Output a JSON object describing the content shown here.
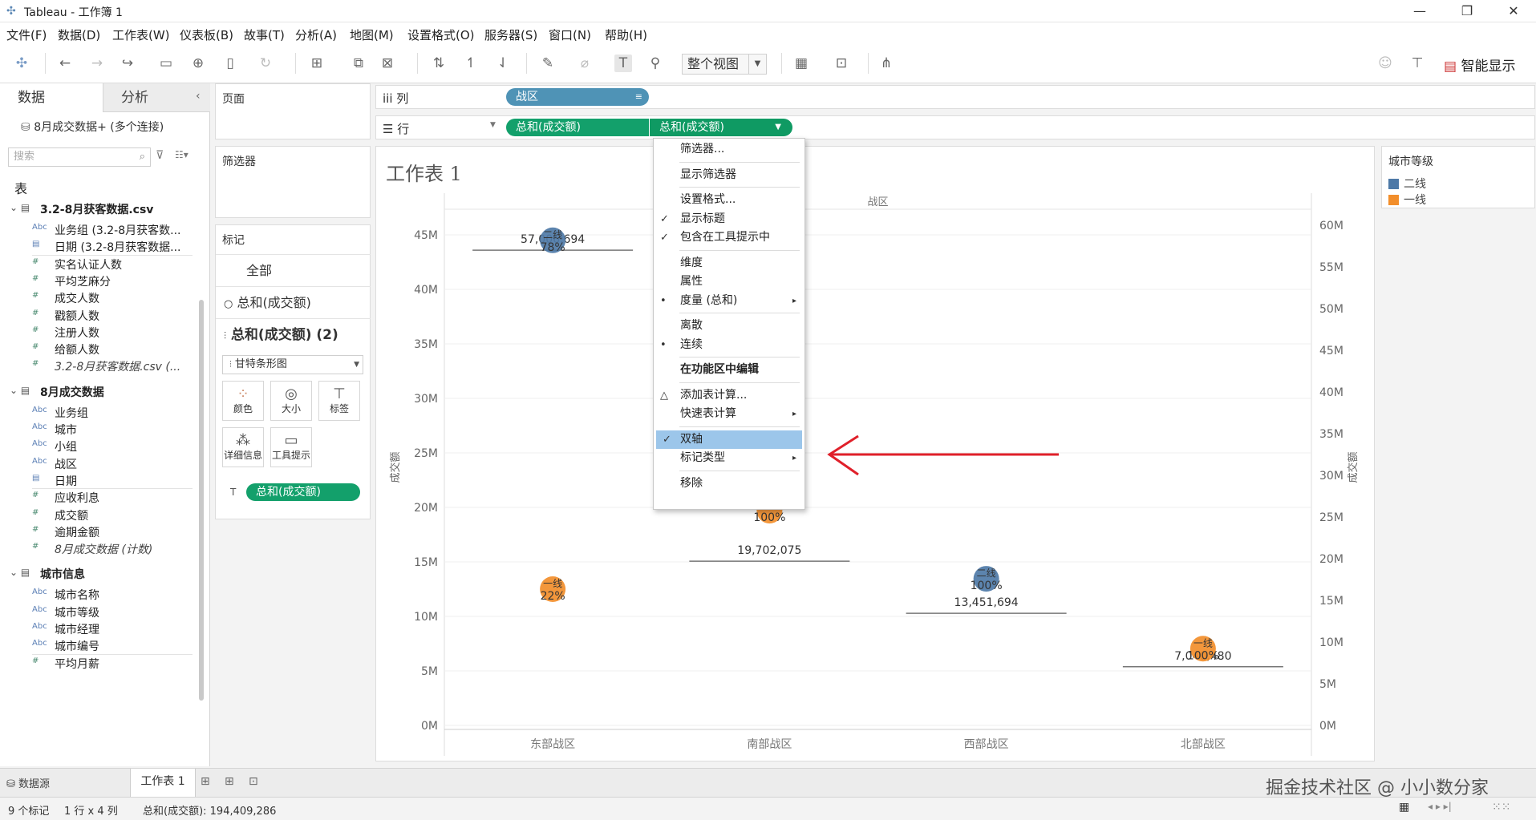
{
  "window": {
    "title": "Tableau - 工作簿 1",
    "minimize": "—",
    "maximize": "❐",
    "close": "✕"
  },
  "menu": [
    "文件(F)",
    "数据(D)",
    "工作表(W)",
    "仪表板(B)",
    "故事(T)",
    "分析(A)",
    "地图(M)",
    "设置格式(O)",
    "服务器(S)",
    "窗口(N)",
    "帮助(H)"
  ],
  "toolbar": {
    "fit_label": "整个视图",
    "show_me_label": "智能显示"
  },
  "left_pane": {
    "tab_data": "数据",
    "tab_analysis": "分析",
    "datasource": "8月成交数据+ (多个连接)",
    "search_placeholder": "搜索",
    "tables_heading": "表",
    "groups": [
      {
        "name": "3.2-8月获客数据.csv",
        "fields": [
          {
            "type": "Abc",
            "name": "业务组 (3.2-8月获客数..."
          },
          {
            "type": "date",
            "name": "日期 (3.2-8月获客数据..."
          },
          {
            "type": "#",
            "name": "实名认证人数"
          },
          {
            "type": "#",
            "name": "平均芝麻分"
          },
          {
            "type": "#",
            "name": "成交人数"
          },
          {
            "type": "#",
            "name": "戳额人数"
          },
          {
            "type": "#",
            "name": "注册人数"
          },
          {
            "type": "#",
            "name": "给额人数"
          },
          {
            "type": "#",
            "name": "3.2-8月获客数据.csv (..."
          }
        ]
      },
      {
        "name": "8月成交数据",
        "fields": [
          {
            "type": "Abc",
            "name": "业务组"
          },
          {
            "type": "Abc",
            "name": "城市"
          },
          {
            "type": "Abc",
            "name": "小组"
          },
          {
            "type": "Abc",
            "name": "战区"
          },
          {
            "type": "date",
            "name": "日期"
          },
          {
            "type": "#",
            "name": "应收利息"
          },
          {
            "type": "#",
            "name": "成交额"
          },
          {
            "type": "#",
            "name": "逾期金额"
          },
          {
            "type": "#",
            "name": "8月成交数据 (计数)"
          }
        ]
      },
      {
        "name": "城市信息",
        "fields": [
          {
            "type": "Abc",
            "name": "城市名称"
          },
          {
            "type": "Abc",
            "name": "城市等级"
          },
          {
            "type": "Abc",
            "name": "城市经理"
          },
          {
            "type": "Abc",
            "name": "城市编号"
          },
          {
            "type": "#",
            "name": "平均月薪"
          }
        ]
      }
    ]
  },
  "cards": {
    "pages": "页面",
    "filters": "筛选器",
    "marks": "标记",
    "marks_all": "全部",
    "marks_m1": "总和(成交额)",
    "marks_m2": "总和(成交额) (2)",
    "mark_type": "甘特条形图",
    "btn_color": "颜色",
    "btn_size": "大小",
    "btn_label": "标签",
    "btn_detail": "详细信息",
    "btn_tooltip": "工具提示",
    "label_pill": "总和(成交额)"
  },
  "shelves": {
    "columns_label": "iii 列",
    "rows_label": "☰ 行",
    "column_pill": "战区",
    "row_pill_1": "总和(成交额)",
    "row_pill_2": "总和(成交额)"
  },
  "view": {
    "sheet_title": "工作表 1"
  },
  "legend": {
    "title": "城市等级",
    "items": [
      {
        "label": "二线",
        "color": "#4e79a7"
      },
      {
        "label": "一线",
        "color": "#f28e2b"
      }
    ]
  },
  "chart_data": {
    "type": "gantt",
    "header": "战区",
    "categories": [
      "东部战区",
      "南部战区",
      "西部战区",
      "北部战区"
    ],
    "ylabel": "成交额",
    "y_left_ticks": [
      "0M",
      "5M",
      "10M",
      "15M",
      "20M",
      "25M",
      "30M",
      "35M",
      "40M",
      "45M"
    ],
    "y_right_ticks": [
      "0M",
      "5M",
      "10M",
      "15M",
      "20M",
      "25M",
      "30M",
      "35M",
      "40M",
      "45M",
      "50M",
      "55M",
      "60M"
    ],
    "ylim_left": [
      0,
      45000000
    ],
    "ylim_right": [
      0,
      60000000
    ],
    "gantt_values": [
      57006694,
      19702075,
      13451694,
      7040480
    ],
    "gantt_labels": [
      "57,006,694",
      "19,702,075",
      "13,451,694",
      "7,040,480"
    ],
    "points": [
      {
        "category": "东部战区",
        "tier": "二线",
        "value": 44500000,
        "label": "78%",
        "tier_label": "二线"
      },
      {
        "category": "东部战区",
        "tier": "一线",
        "value": 12500000,
        "label": "22%",
        "tier_label": "一线"
      },
      {
        "category": "南部战区",
        "tier": "一线",
        "value": 19700000,
        "label": "100%",
        "tier_label": "一线"
      },
      {
        "category": "西部战区",
        "tier": "二线",
        "value": 13450000,
        "label": "100%",
        "tier_label": "二线"
      },
      {
        "category": "北部战区",
        "tier": "一线",
        "value": 7040000,
        "label": "100%",
        "tier_label": "一线"
      }
    ]
  },
  "context_menu": {
    "items": [
      {
        "label": "筛选器...",
        "check": "",
        "sub": false
      },
      {
        "sep": true
      },
      {
        "label": "显示筛选器",
        "check": "",
        "sub": false
      },
      {
        "sep": true
      },
      {
        "label": "设置格式...",
        "check": "",
        "sub": false
      },
      {
        "label": "显示标题",
        "check": "✓",
        "sub": false
      },
      {
        "label": "包含在工具提示中",
        "check": "✓",
        "sub": false
      },
      {
        "sep": true
      },
      {
        "label": "维度",
        "check": "",
        "sub": false
      },
      {
        "label": "属性",
        "check": "",
        "sub": false
      },
      {
        "label": "度量 (总和)",
        "check": "•",
        "sub": true
      },
      {
        "sep": true
      },
      {
        "label": "离散",
        "check": "",
        "sub": false
      },
      {
        "label": "连续",
        "check": "•",
        "sub": false
      },
      {
        "sep": true
      },
      {
        "label": "在功能区中编辑",
        "check": "",
        "sub": false,
        "bold": true
      },
      {
        "sep": true
      },
      {
        "label": "添加表计算...",
        "check": "△",
        "sub": false
      },
      {
        "label": "快速表计算",
        "check": "",
        "sub": true
      },
      {
        "sep": true
      },
      {
        "label": "双轴",
        "check": "✓",
        "sub": false,
        "highlight": true
      },
      {
        "label": "标记类型",
        "check": "",
        "sub": true
      },
      {
        "sep": true
      },
      {
        "label": "移除",
        "check": "",
        "sub": false
      }
    ]
  },
  "bottom": {
    "datasource_tab": "数据源",
    "sheet_tab": "工作表 1",
    "status_marks": "9 个标记",
    "status_rc": "1 行 x 4 列",
    "status_sum": "总和(成交额): 194,409,286",
    "watermark": "掘金技术社区 @ 小小数分家"
  }
}
